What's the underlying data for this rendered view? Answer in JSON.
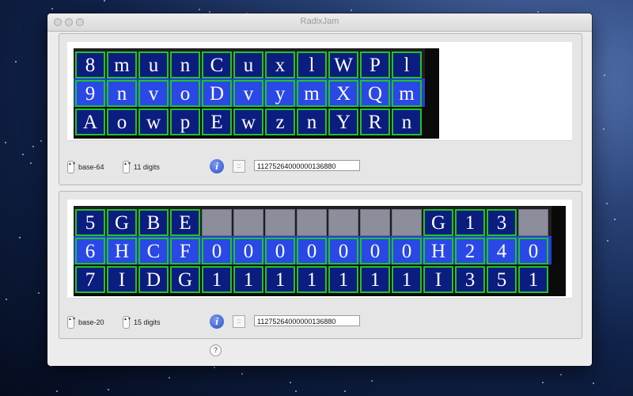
{
  "window": {
    "title": "RadixJam"
  },
  "panel1": {
    "grid_rows": [
      [
        "8",
        "m",
        "u",
        "n",
        "C",
        "u",
        "x",
        "l",
        "W",
        "P",
        "l"
      ],
      [
        "9",
        "n",
        "v",
        "o",
        "D",
        "v",
        "y",
        "m",
        "X",
        "Q",
        "m"
      ],
      [
        "A",
        "o",
        "w",
        "p",
        "E",
        "w",
        "z",
        "n",
        "Y",
        "R",
        "n"
      ]
    ],
    "base": "base-64",
    "digits": "11 digits",
    "value": "11275264000000136880"
  },
  "panel2": {
    "grid_rows": [
      [
        "5",
        "G",
        "B",
        "E",
        "",
        "",
        "",
        "",
        "",
        "",
        "",
        "G",
        "1",
        "3",
        ""
      ],
      [
        "6",
        "H",
        "C",
        "F",
        "0",
        "0",
        "0",
        "0",
        "0",
        "0",
        "0",
        "H",
        "2",
        "4",
        "0"
      ],
      [
        "7",
        "I",
        "D",
        "G",
        "1",
        "1",
        "1",
        "1",
        "1",
        "1",
        "1",
        "I",
        "3",
        "5",
        "1"
      ]
    ],
    "base": "base-20",
    "digits": "15 digits",
    "value": "11275264000000136880"
  },
  "icons": {
    "info": "i",
    "grid": "::",
    "stepper": "▲▼",
    "help": "?"
  },
  "colors": {
    "cell_navy": "#0c1d80",
    "cell_blue": "#2a48e6",
    "cell_border": "#22c22a",
    "empty_cell": "#8c8e9c"
  }
}
